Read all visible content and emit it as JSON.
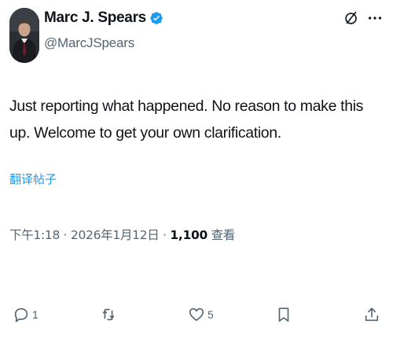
{
  "tweet": {
    "author": {
      "display_name": "Marc J. Spears",
      "handle": "@MarcJSpears",
      "verified": true,
      "avatar_icon": "profile-photo"
    },
    "header_icons": [
      "grok-icon",
      "more-icon"
    ],
    "text": "Just reporting what happened. No reason to make this up. Welcome to get your own clarification.",
    "translate_label": "翻译帖子",
    "time": "下午1:18",
    "separator": "·",
    "date": "2026年1月12日",
    "views_count": "1,100",
    "views_label": "查看"
  },
  "actions": {
    "reply": {
      "icon": "reply-icon",
      "count": "1"
    },
    "repost": {
      "icon": "repost-icon",
      "count": ""
    },
    "like": {
      "icon": "like-icon",
      "count": "5"
    },
    "bookmark": {
      "icon": "bookmark-icon",
      "count": ""
    },
    "share": {
      "icon": "share-icon",
      "count": ""
    }
  },
  "colors": {
    "text_primary": "#0f1419",
    "text_secondary": "#536471",
    "link": "#1d9bf0",
    "verified": "#1d9bf0"
  }
}
